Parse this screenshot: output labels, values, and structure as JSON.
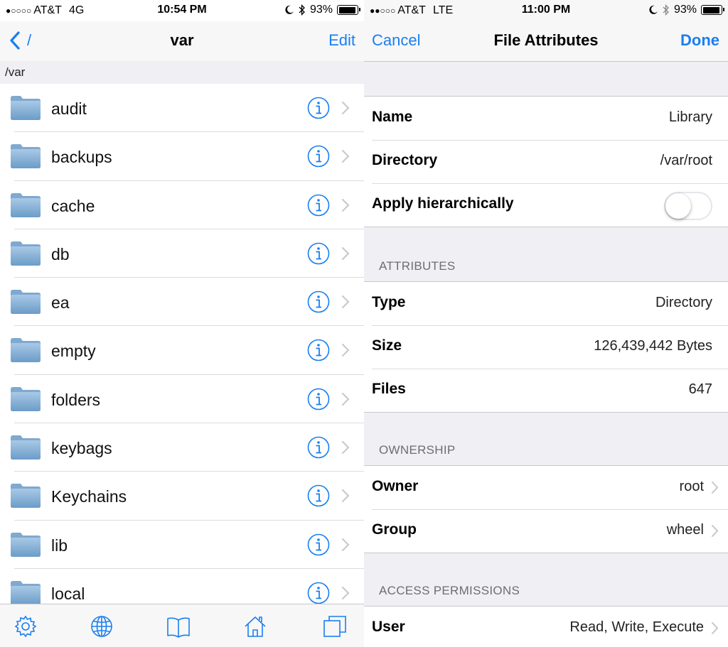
{
  "left": {
    "status": {
      "signal": "●○○○○",
      "carrier": "AT&T",
      "network": "4G",
      "time": "10:54 PM",
      "battery": "93%",
      "battery_level": 0.93
    },
    "nav": {
      "back_label": "/",
      "title": "var",
      "edit_label": "Edit"
    },
    "path": "/var",
    "folders": [
      "audit",
      "backups",
      "cache",
      "db",
      "ea",
      "empty",
      "folders",
      "keybags",
      "Keychains",
      "lib",
      "local"
    ],
    "tabs": [
      "gear-icon",
      "globe-icon",
      "book-icon",
      "home-icon",
      "windows-icon"
    ],
    "accent": "#1a7ff0"
  },
  "right": {
    "status": {
      "signal": "●●○○○",
      "carrier": "AT&T",
      "network": "LTE",
      "time": "11:00 PM",
      "battery": "93%",
      "battery_level": 0.93
    },
    "nav": {
      "cancel_label": "Cancel",
      "title": "File Attributes",
      "done_label": "Done"
    },
    "general": {
      "name_label": "Name",
      "name_value": "Library",
      "directory_label": "Directory",
      "directory_value": "/var/root",
      "apply_label": "Apply hierarchically",
      "apply_on": false
    },
    "attributes": {
      "header": "ATTRIBUTES",
      "type_label": "Type",
      "type_value": "Directory",
      "size_label": "Size",
      "size_value": "126,439,442 Bytes",
      "files_label": "Files",
      "files_value": "647"
    },
    "ownership": {
      "header": "OWNERSHIP",
      "owner_label": "Owner",
      "owner_value": "root",
      "group_label": "Group",
      "group_value": "wheel"
    },
    "permissions": {
      "header": "ACCESS PERMISSIONS",
      "user_label": "User",
      "user_value": "Read, Write, Execute"
    }
  }
}
